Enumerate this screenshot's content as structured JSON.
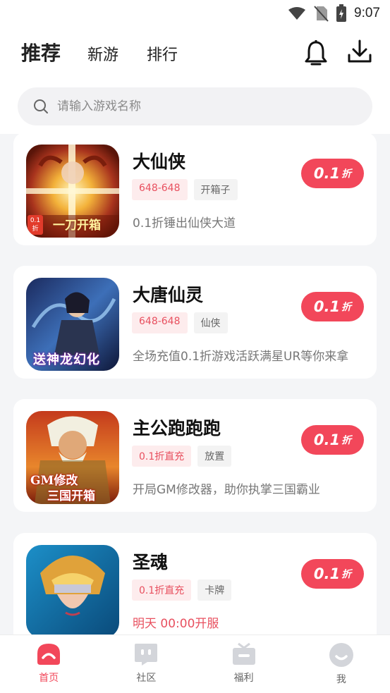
{
  "status_bar": {
    "time": "9:07"
  },
  "header": {
    "tabs": [
      {
        "label": "推荐",
        "active": true
      },
      {
        "label": "新游",
        "active": false
      },
      {
        "label": "排行",
        "active": false
      }
    ]
  },
  "search": {
    "placeholder": "请输入游戏名称"
  },
  "games": [
    {
      "name": "大仙侠",
      "tags": [
        {
          "text": "648-648",
          "style": "red"
        },
        {
          "text": "开箱子",
          "style": "gray"
        }
      ],
      "description": "0.1折锤出仙侠大道",
      "discount": "0.1",
      "discount_unit": "折",
      "icon_overlay": "一刀开箱",
      "icon_badge": "0.1折"
    },
    {
      "name": "大唐仙灵",
      "tags": [
        {
          "text": "648-648",
          "style": "red"
        },
        {
          "text": "仙侠",
          "style": "gray"
        }
      ],
      "description": "全场充值0.1折游戏活跃满星UR等你来拿",
      "discount": "0.1",
      "discount_unit": "折",
      "icon_overlay": "送神龙幻化"
    },
    {
      "name": "主公跑跑跑",
      "tags": [
        {
          "text": "0.1折直充",
          "style": "red"
        },
        {
          "text": "放置",
          "style": "gray"
        }
      ],
      "description": "开局GM修改器，助你执掌三国霸业",
      "discount": "0.1",
      "discount_unit": "折",
      "icon_overlay": "GM修改",
      "icon_overlay2": "三国开箱"
    },
    {
      "name": "圣魂",
      "tags": [
        {
          "text": "0.1折直充",
          "style": "red"
        },
        {
          "text": "卡牌",
          "style": "gray"
        }
      ],
      "description": "明天 00:00开服",
      "description_highlight": true,
      "discount": "0.1",
      "discount_unit": "折"
    }
  ],
  "bottom_nav": [
    {
      "label": "首页",
      "icon": "home-icon",
      "active": true
    },
    {
      "label": "社区",
      "icon": "chat-icon",
      "active": false
    },
    {
      "label": "福利",
      "icon": "gift-icon",
      "active": false
    },
    {
      "label": "我",
      "icon": "profile-icon",
      "active": false
    }
  ],
  "colors": {
    "accent": "#f2475a",
    "tag_red_bg": "#fdeced",
    "tag_red_text": "#e8505f"
  }
}
